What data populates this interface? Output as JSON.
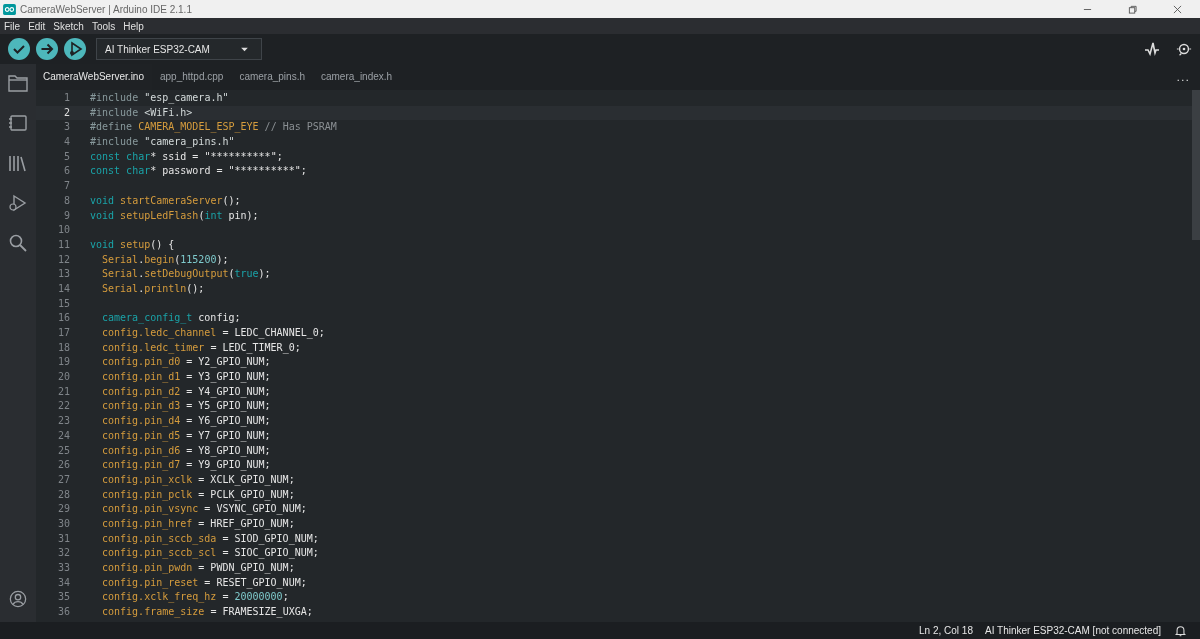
{
  "window": {
    "title": "CameraWebServer | Arduino IDE 2.1.1"
  },
  "menu": [
    "File",
    "Edit",
    "Sketch",
    "Tools",
    "Help"
  ],
  "board_selector": {
    "value": "AI Thinker ESP32-CAM"
  },
  "tabs": [
    {
      "label": "CameraWebServer.ino",
      "selected": true
    },
    {
      "label": "app_httpd.cpp",
      "selected": false
    },
    {
      "label": "camera_pins.h",
      "selected": false
    },
    {
      "label": "camera_index.h",
      "selected": false
    }
  ],
  "tabs_more": "...",
  "editor": {
    "lines": [
      {
        "number": "1",
        "selected": false,
        "indented": false,
        "tokens": [
          {
            "text": "#include ",
            "kind": "pre"
          },
          {
            "text": "\"esp_camera.h\"",
            "kind": "str"
          }
        ]
      },
      {
        "number": "2",
        "selected": true,
        "indented": false,
        "tokens": [
          {
            "text": "#include ",
            "kind": "pre"
          },
          {
            "text": "<WiFi.h>",
            "kind": "str"
          }
        ]
      },
      {
        "number": "3",
        "selected": false,
        "indented": false,
        "tokens": [
          {
            "text": "#define ",
            "kind": "pre"
          },
          {
            "text": "CAMERA_MODEL_ESP_EYE ",
            "kind": "fn"
          },
          {
            "text": "// Has PSRAM",
            "kind": "comment"
          }
        ]
      },
      {
        "number": "4",
        "selected": false,
        "indented": false,
        "tokens": [
          {
            "text": "#include ",
            "kind": "pre"
          },
          {
            "text": "\"camera_pins.h\"",
            "kind": "str"
          }
        ]
      },
      {
        "number": "5",
        "selected": false,
        "indented": false,
        "tokens": [
          {
            "text": "const char",
            "kind": "type"
          },
          {
            "text": "* ssid = \"**********\";",
            "kind": "plain"
          }
        ]
      },
      {
        "number": "6",
        "selected": false,
        "indented": false,
        "tokens": [
          {
            "text": "const char",
            "kind": "type"
          },
          {
            "text": "* password = \"**********\";",
            "kind": "plain"
          }
        ]
      },
      {
        "number": "7",
        "selected": false
      },
      {
        "number": "8",
        "selected": false,
        "indented": false,
        "tokens": [
          {
            "text": "void ",
            "kind": "type"
          },
          {
            "text": "startCameraServer",
            "kind": "fn"
          },
          {
            "text": "();",
            "kind": "plain"
          }
        ]
      },
      {
        "number": "9",
        "selected": false,
        "indented": false,
        "tokens": [
          {
            "text": "void ",
            "kind": "type"
          },
          {
            "text": "setupLedFlash",
            "kind": "fn"
          },
          {
            "text": "(",
            "kind": "plain"
          },
          {
            "text": "int ",
            "kind": "type"
          },
          {
            "text": "pin);",
            "kind": "plain"
          }
        ]
      },
      {
        "number": "10",
        "selected": false
      },
      {
        "number": "11",
        "selected": false,
        "indented": false,
        "tokens": [
          {
            "text": "void ",
            "kind": "type"
          },
          {
            "text": "setup",
            "kind": "fn"
          },
          {
            "text": "() {",
            "kind": "plain"
          }
        ]
      },
      {
        "number": "12",
        "selected": false,
        "indented": true,
        "tokens": [
          {
            "text": "Serial",
            "kind": "fn"
          },
          {
            "text": ".",
            "kind": "plain"
          },
          {
            "text": "begin",
            "kind": "fn"
          },
          {
            "text": "(",
            "kind": "plain"
          },
          {
            "text": "115200",
            "kind": "num"
          },
          {
            "text": ");",
            "kind": "plain"
          }
        ]
      },
      {
        "number": "13",
        "selected": false,
        "indented": true,
        "tokens": [
          {
            "text": "Serial",
            "kind": "fn"
          },
          {
            "text": ".",
            "kind": "plain"
          },
          {
            "text": "setDebugOutput",
            "kind": "fn"
          },
          {
            "text": "(",
            "kind": "plain"
          },
          {
            "text": "true",
            "kind": "type"
          },
          {
            "text": ");",
            "kind": "plain"
          }
        ]
      },
      {
        "number": "14",
        "selected": false,
        "indented": true,
        "tokens": [
          {
            "text": "Serial",
            "kind": "fn"
          },
          {
            "text": ".",
            "kind": "plain"
          },
          {
            "text": "println",
            "kind": "fn"
          },
          {
            "text": "();",
            "kind": "plain"
          }
        ]
      },
      {
        "number": "15",
        "selected": false
      },
      {
        "number": "16",
        "selected": false,
        "indented": true,
        "tokens": [
          {
            "text": "camera_config_t ",
            "kind": "type"
          },
          {
            "text": "config;",
            "kind": "plain"
          }
        ]
      },
      {
        "number": "17",
        "selected": false,
        "indented": true,
        "tokens": [
          {
            "text": "config.ledc_channel",
            "kind": "fn"
          },
          {
            "text": " = LEDC_CHANNEL_0;",
            "kind": "plain"
          }
        ]
      },
      {
        "number": "18",
        "selected": false,
        "indented": true,
        "tokens": [
          {
            "text": "config.ledc_timer",
            "kind": "fn"
          },
          {
            "text": " = LEDC_TIMER_0;",
            "kind": "plain"
          }
        ]
      },
      {
        "number": "19",
        "selected": false,
        "indented": true,
        "tokens": [
          {
            "text": "config.pin_d0",
            "kind": "fn"
          },
          {
            "text": " = Y2_GPIO_NUM;",
            "kind": "plain"
          }
        ]
      },
      {
        "number": "20",
        "selected": false,
        "indented": true,
        "tokens": [
          {
            "text": "config.pin_d1",
            "kind": "fn"
          },
          {
            "text": " = Y3_GPIO_NUM;",
            "kind": "plain"
          }
        ]
      },
      {
        "number": "21",
        "selected": false,
        "indented": true,
        "tokens": [
          {
            "text": "config.pin_d2",
            "kind": "fn"
          },
          {
            "text": " = Y4_GPIO_NUM;",
            "kind": "plain"
          }
        ]
      },
      {
        "number": "22",
        "selected": false,
        "indented": true,
        "tokens": [
          {
            "text": "config.pin_d3",
            "kind": "fn"
          },
          {
            "text": " = Y5_GPIO_NUM;",
            "kind": "plain"
          }
        ]
      },
      {
        "number": "23",
        "selected": false,
        "indented": true,
        "tokens": [
          {
            "text": "config.pin_d4",
            "kind": "fn"
          },
          {
            "text": " = Y6_GPIO_NUM;",
            "kind": "plain"
          }
        ]
      },
      {
        "number": "24",
        "selected": false,
        "indented": true,
        "tokens": [
          {
            "text": "config.pin_d5",
            "kind": "fn"
          },
          {
            "text": " = Y7_GPIO_NUM;",
            "kind": "plain"
          }
        ]
      },
      {
        "number": "25",
        "selected": false,
        "indented": true,
        "tokens": [
          {
            "text": "config.pin_d6",
            "kind": "fn"
          },
          {
            "text": " = Y8_GPIO_NUM;",
            "kind": "plain"
          }
        ]
      },
      {
        "number": "26",
        "selected": false,
        "indented": true,
        "tokens": [
          {
            "text": "config.pin_d7",
            "kind": "fn"
          },
          {
            "text": " = Y9_GPIO_NUM;",
            "kind": "plain"
          }
        ]
      },
      {
        "number": "27",
        "selected": false,
        "indented": true,
        "tokens": [
          {
            "text": "config.pin_xclk",
            "kind": "fn"
          },
          {
            "text": " = XCLK_GPIO_NUM;",
            "kind": "plain"
          }
        ]
      },
      {
        "number": "28",
        "selected": false,
        "indented": true,
        "tokens": [
          {
            "text": "config.pin_pclk",
            "kind": "fn"
          },
          {
            "text": " = PCLK_GPIO_NUM;",
            "kind": "plain"
          }
        ]
      },
      {
        "number": "29",
        "selected": false,
        "indented": true,
        "tokens": [
          {
            "text": "config.pin_vsync",
            "kind": "fn"
          },
          {
            "text": " = VSYNC_GPIO_NUM;",
            "kind": "plain"
          }
        ]
      },
      {
        "number": "30",
        "selected": false,
        "indented": true,
        "tokens": [
          {
            "text": "config.pin_href",
            "kind": "fn"
          },
          {
            "text": " = HREF_GPIO_NUM;",
            "kind": "plain"
          }
        ]
      },
      {
        "number": "31",
        "selected": false,
        "indented": true,
        "tokens": [
          {
            "text": "config.pin_sccb_sda",
            "kind": "fn"
          },
          {
            "text": " = SIOD_GPIO_NUM;",
            "kind": "plain"
          }
        ]
      },
      {
        "number": "32",
        "selected": false,
        "indented": true,
        "tokens": [
          {
            "text": "config.pin_sccb_scl",
            "kind": "fn"
          },
          {
            "text": " = SIOC_GPIO_NUM;",
            "kind": "plain"
          }
        ]
      },
      {
        "number": "33",
        "selected": false,
        "indented": true,
        "tokens": [
          {
            "text": "config.pin_pwdn",
            "kind": "fn"
          },
          {
            "text": " = PWDN_GPIO_NUM;",
            "kind": "plain"
          }
        ]
      },
      {
        "number": "34",
        "selected": false,
        "indented": true,
        "tokens": [
          {
            "text": "config.pin_reset",
            "kind": "fn"
          },
          {
            "text": " = RESET_GPIO_NUM;",
            "kind": "plain"
          }
        ]
      },
      {
        "number": "35",
        "selected": false,
        "indented": true,
        "tokens": [
          {
            "text": "config.xclk_freq_hz",
            "kind": "fn"
          },
          {
            "text": " = ",
            "kind": "plain"
          },
          {
            "text": "20000000",
            "kind": "num"
          },
          {
            "text": ";",
            "kind": "plain"
          }
        ]
      },
      {
        "number": "36",
        "selected": false,
        "indented": true,
        "tokens": [
          {
            "text": "config.frame_size",
            "kind": "fn"
          },
          {
            "text": " = FRAMESIZE_UXGA;",
            "kind": "plain"
          }
        ]
      }
    ]
  },
  "status_bar": {
    "position": "Ln 2, Col 18",
    "board": "AI Thinker ESP32-CAM [not connected]"
  }
}
